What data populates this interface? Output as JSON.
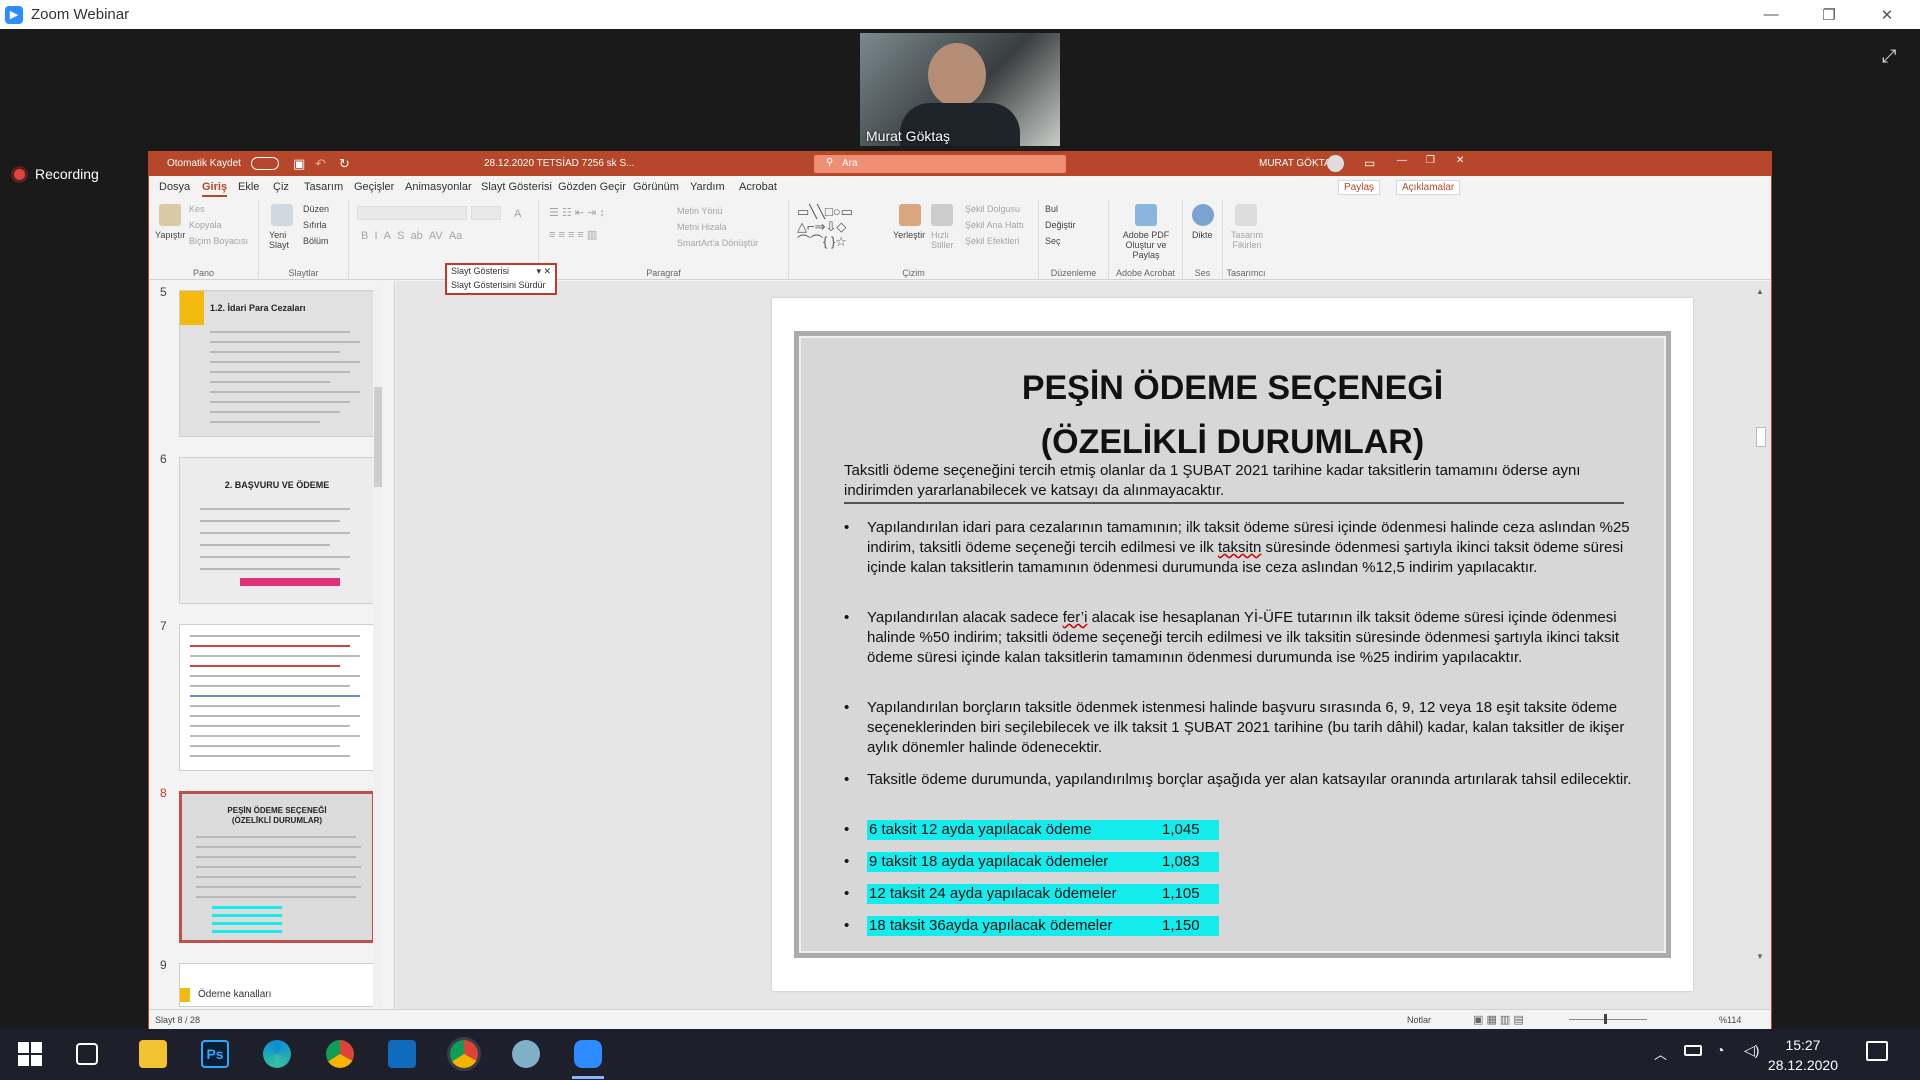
{
  "zoom": {
    "window_title": "Zoom Webinar",
    "participant_name": "Murat Göktaş",
    "recording_label": "Recording",
    "minimize_glyph": "—",
    "restore_glyph": "❐",
    "close_glyph": "✕",
    "expand_glyph": "⤢"
  },
  "ppt": {
    "autosave_label": "Otomatik Kaydet",
    "file_name": "28.12.2020 TETSİAD 7256 sk S...",
    "search_placeholder": "Ara",
    "user_name": "MURAT GÖKTAŞ",
    "tabs": [
      "Dosya",
      "Giriş",
      "Ekle",
      "Çiz",
      "Tasarım",
      "Geçişler",
      "Animasyonlar",
      "Slayt Gösterisi",
      "Gözden Geçir",
      "Görünüm",
      "Yardım",
      "Acrobat"
    ],
    "share_label": "Paylaş",
    "comments_label": "Açıklamalar",
    "ribbon": {
      "pano": {
        "paste": "Yapıştır",
        "cut": "Kes",
        "copy": "Kopyala",
        "format_painter": "Biçim Boyacısı",
        "label": "Pano"
      },
      "slaytlar": {
        "new_slide": "Yeni Slayt",
        "layout": "Düzen",
        "reset": "Sıfırla",
        "section": "Bölüm",
        "label": "Slaytlar"
      },
      "paragraf": {
        "text_direction": "Metin Yönü",
        "align_text": "Metni Hizala",
        "smartart": "SmartArt'a Dönüştür",
        "label": "Paragraf"
      },
      "cizim": {
        "arrange": "Yerleştir",
        "quick_styles": "Hızlı Stiller",
        "shape_fill": "Şekil Dolgusu",
        "shape_outline": "Şekil Ana Hattı",
        "shape_effects": "Şekil Efektleri",
        "label": "Çizim"
      },
      "duzenleme": {
        "find": "Bul",
        "replace": "Değiştir",
        "select": "Seç",
        "label": "Düzenleme"
      },
      "acrobat": {
        "create": "Adobe PDF Oluştur ve Paylaş",
        "label": "Adobe Acrobat"
      },
      "ses": {
        "dictate": "Dikte",
        "label": "Ses"
      },
      "tasarimci": {
        "ideas": "Tasarım Fikirleri",
        "label": "Tasarımcı"
      }
    },
    "popup": {
      "item1": "Slayt Gösterisi",
      "item2": "Slayt Gösterisini Sürdür"
    },
    "thumbnails": [
      {
        "num": "5",
        "title": "1.2. İdari Para Cezaları"
      },
      {
        "num": "6",
        "title": "2. BAŞVURU VE ÖDEME"
      },
      {
        "num": "7",
        "title": ""
      },
      {
        "num": "8",
        "title": "PEŞİN ÖDEME SEÇENEĞİ (ÖZELİKLİ DURUMLAR)"
      },
      {
        "num": "9",
        "title": "Ödeme kanalları"
      }
    ],
    "status": {
      "slide_count": "Slayt 8 / 28",
      "notes": "Notlar",
      "zoom": "%114"
    }
  },
  "slide": {
    "title_line1": "PEŞİN ÖDEME SEÇENEGİ",
    "title_line2": "(ÖZELİKLİ DURUMLAR)",
    "intro": "Taksitli ödeme seçeneğini tercih etmiş olanlar da 1 ŞUBAT 2021 tarihine kadar taksitlerin tamamını öderse aynı indirimden yararlanabilecek ve katsayı da alınmayacaktır.",
    "bullet_glyph": "•",
    "bullet1_a": "Yapılandırılan idari para cezalarının tamamının; ilk taksit ödeme süresi içinde ödenmesi halinde ceza aslından %25 indirim, taksitli ödeme seçeneği tercih edilmesi ve ilk ",
    "bullet1_u": "taksitn",
    "bullet1_b": " süresinde ödenmesi şartıyla ikinci taksit ödeme süresi içinde kalan taksitlerin tamamının ödenmesi durumunda ise ceza aslından %12,5 indirim yapılacaktır.",
    "bullet2_a": "Yapılandırılan alacak sadece ",
    "bullet2_u": "fer’i",
    "bullet2_b": " alacak ise hesaplanan Yİ-ÜFE tutarının ilk taksit ödeme süresi içinde ödenmesi halinde %50 indirim; taksitli ödeme seçeneği tercih edilmesi ve ilk taksitin süresinde ödenmesi şartıyla ikinci taksit ödeme süresi içinde kalan taksitlerin tamamının ödenmesi durumunda ise %25 indirim yapılacaktır.",
    "bullet3": "Yapılandırılan borçların taksitle ödenmek istenmesi halinde başvuru sırasında 6, 9, 12 veya 18 eşit taksite ödeme seçeneklerinden biri seçilebilecek ve ilk taksit 1 ŞUBAT 2021 tarihine (bu tarih dâhil) kadar, kalan taksitler de ikişer aylık dönemler halinde ödenecektir.",
    "bullet4": "Taksitle ödeme durumunda, yapılandırılmış borçlar aşağıda yer alan katsayılar oranında artırılarak tahsil edilecektir.",
    "coefficients": [
      {
        "label": "6 taksit 12 ayda yapılacak ödeme",
        "value": "1,045"
      },
      {
        "label": "9 taksit 18 ayda yapılacak ödemeler",
        "value": "1,083"
      },
      {
        "label": "12 taksit 24 ayda yapılacak ödemeler",
        "value": "1,105"
      },
      {
        "label": "18 taksit 36ayda yapılacak ödemeler",
        "value": "1,150"
      }
    ]
  },
  "taskbar": {
    "time": "15:27",
    "date": "28.12.2020",
    "ps_label": "Ps"
  },
  "colors": {
    "ppt_accent": "#b7472a",
    "highlight": "#13ecec",
    "zoom_blue": "#2d8cff"
  }
}
